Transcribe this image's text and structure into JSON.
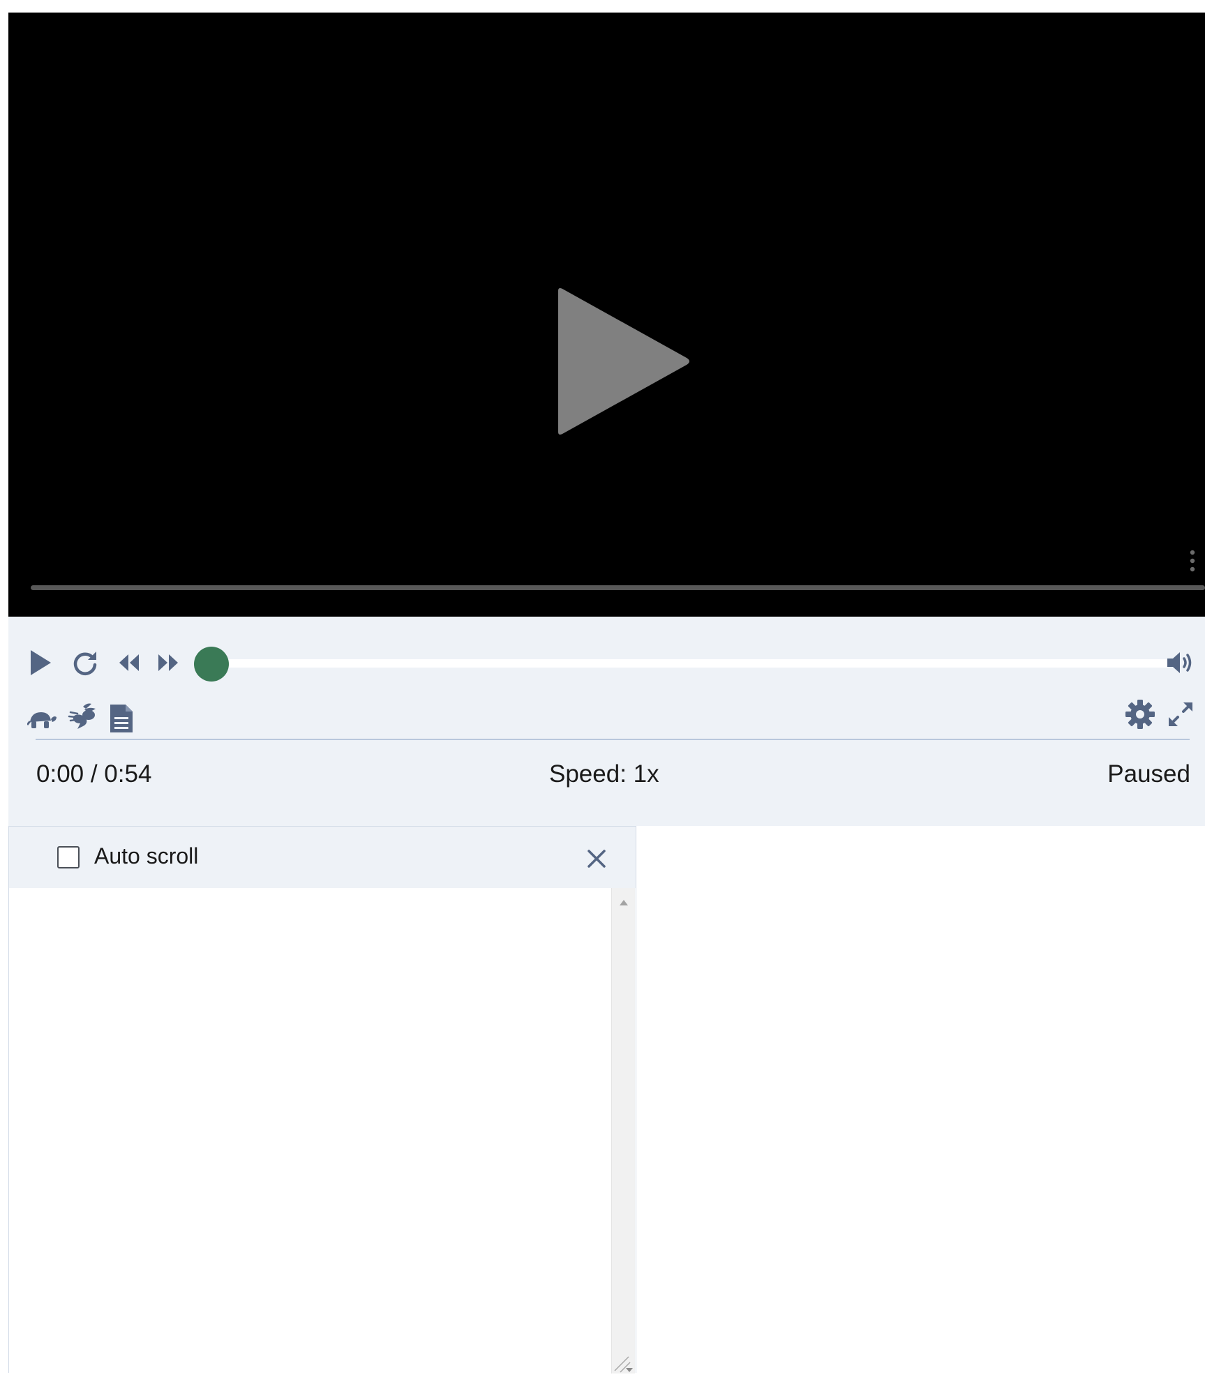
{
  "player": {
    "time_display": "0:00 / 0:54",
    "speed_display": "Speed: 1x",
    "state_display": "Paused",
    "progress": 0.0,
    "accent_color": "#3a7a56",
    "controls_bg": "#eef2f7",
    "icons": {
      "big_play": "play-triangle",
      "more": "vertical-ellipsis",
      "play": "play",
      "replay": "rotate-cw",
      "rewind": "double-chevron-left",
      "forward": "double-chevron-right",
      "volume": "speaker-wave",
      "slower": "turtle",
      "faster": "rabbit",
      "transcript": "document",
      "settings": "gear",
      "fullscreen": "expand-arrows"
    }
  },
  "transcript": {
    "autoscroll_label": "Auto scroll",
    "autoscroll_checked": false,
    "close_icon": "close-x"
  }
}
